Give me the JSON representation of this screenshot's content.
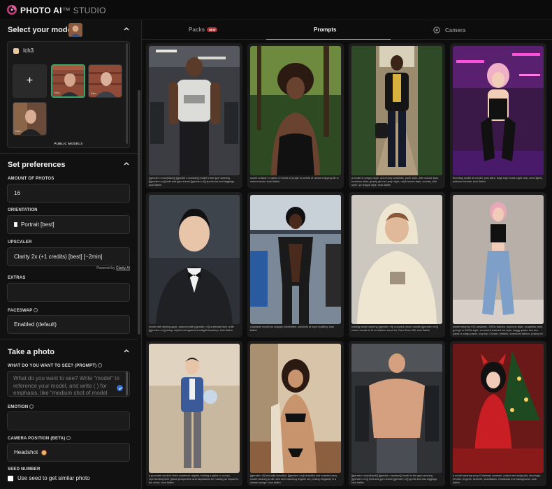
{
  "app": {
    "brand_main": "PHOTO AI",
    "brand_sub": "™ STUDIO"
  },
  "tabs": [
    {
      "label": "Packs",
      "badge": "NEW",
      "active": false
    },
    {
      "label": "Prompts",
      "active": true
    },
    {
      "label": "Camera",
      "active": false
    }
  ],
  "sidebar": {
    "model_section": {
      "title": "Select your model",
      "current_model": "Ich3",
      "add_label": "+",
      "public_models_label": "PUBLIC MODELS",
      "thumbs": [
        {
          "tag": "Kiko"
        },
        {
          "tag": "Kiko"
        },
        {
          "tag": "Kiko"
        }
      ]
    },
    "preferences": {
      "title": "Set preferences",
      "amount_label": "AMOUNT OF PHOTOS",
      "amount_value": "16",
      "orientation_label": "ORIENTATION",
      "orientation_value": "Portrait [best]",
      "upscaler_label": "UPSCALER",
      "upscaler_value": "Clarity 2x (+1 credits) [best] [~2min]",
      "powered_by": "Powered by",
      "powered_by_link": "Clarity AI",
      "extras_label": "EXTRAS",
      "extras_value": "",
      "faceswap_label": "FACESWAP",
      "faceswap_value": "Enabled (default)"
    },
    "take_photo": {
      "title": "Take a photo",
      "prompt_label": "WHAT DO YOU WANT TO SEE? (PROMPT)",
      "prompt_placeholder": "What do you want to see? Write \"model\" to reference your model, and write ( ) for emphasis, like \"medium shot of model",
      "emotion_label": "EMOTION",
      "emotion_value": "",
      "camera_label": "CAMERA POSITION (BETA)",
      "camera_value": "Headshot",
      "seed_label": "SEED NUMBER",
      "seed_checkbox_label": "Use seed to get similar photo"
    }
  },
  "colors": {
    "accent_green": "#3aa366",
    "badge_red": "#a83030",
    "link_blue": "#2f6fd8"
  },
  "gallery": [
    {
      "caption": "[[gender==man|black]] [[gender==woman]] model in the gym wearing [[gender==m]] shirt and gym shorts [[gender==f]] sports bra and leggings, took flatlim"
    },
    {
      "caption": "model outside in nature in forest or jungle on a field of wheat enjoying life in natural world, took flatlim"
    },
    {
      "caption": "a model in preppy style, old money aesthetic, posh style, elite school style, luxurious style, gossip girl neo-prep style, ralph lauren style, country club style, ivy league style, took flatlim"
    },
    {
      "caption": "breeding model as model, pink latex, thigh high boots night club, neon lights, platinum blonde, took flatlim"
    },
    {
      "caption": "model with striking gaze, adorned with [[gender==f]] a delicate lace outfit [[gender==m]] sharp, stylish suit against a twilight backdrop, took flatlim"
    },
    {
      "caption": "cosplayer model as cosplay convention, outdoors at expo building, took flatlim"
    },
    {
      "caption": "smiling model wearing [[gender==f]] cropped cream hoodie [[gender==m]] cream hoodie in fit on fashion shoot for Cara Sheer Ifill, took flatlim"
    },
    {
      "caption": "model wearing Y2K aesthetic, 2000s fashion, euphoric style, noughties style, grunge or 2000s style, oversized washed out style, baggy pants, low rise pants or cargo pants, crop top, Choker, Metallic, iridescent fabrics, posing for a photo, took flatlim"
    },
    {
      "caption": "a graduate model in their academic regalia, holding a globe or a map, representing their global perspective and aspirations for making an impact in the world, took flatlim"
    },
    {
      "caption": "[[gender==f]] sexually beautiful, [[gender==m]] beautiful and muscled sexy model wearing a silk robe and matching lingerie set, posing elegantly in a chaise lounge, took flatlim"
    },
    {
      "caption": "[[gender==man|black]] [[gender==woman]] model in the gym wearing [[gender==m]] shirt and gym shorts [[gender==f]] sports bra and leggings, took flatlim"
    },
    {
      "caption": "a model wearing sexy Christmas costume, (naked red bodysuit), stockings, elf ears, lingerie, fishnets, snowflakes, Christmas tree background, took flatlim"
    }
  ]
}
